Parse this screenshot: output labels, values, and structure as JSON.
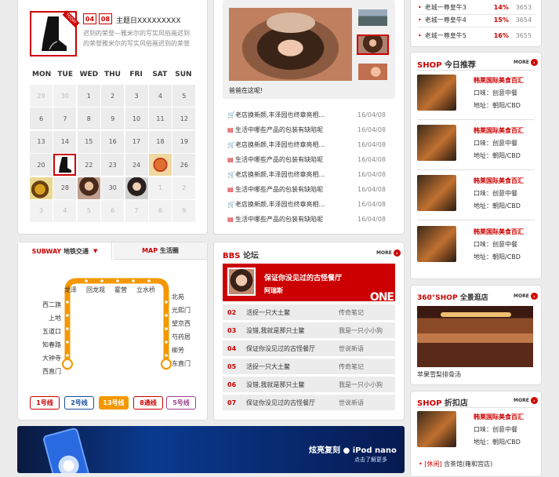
{
  "calendar": {
    "badge_month": "04",
    "badge_day": "08",
    "theme_title": "主题日XXXXXXXXX",
    "desc": "迟到的荣誉—雅米尔的写实风俗画迟到的荣誉雅米尔的写实风俗画迟到的荣誉",
    "weekdays": [
      "MON",
      "TUE",
      "WED",
      "THU",
      "FRI",
      "SAT",
      "SUN"
    ],
    "rows": [
      [
        "29",
        "30",
        "1",
        "2",
        "3",
        "4",
        "5"
      ],
      [
        "6",
        "7",
        "8",
        "9",
        "10",
        "11",
        "12"
      ],
      [
        "13",
        "14",
        "15",
        "16",
        "17",
        "18",
        "19"
      ],
      [
        "20",
        "",
        "22",
        "23",
        "24",
        "",
        "26"
      ],
      [
        "",
        "28",
        "",
        "30",
        "",
        "1",
        "2"
      ],
      [
        "3",
        "4",
        "5",
        "6",
        "7",
        "8",
        "9"
      ]
    ]
  },
  "top_right_list": [
    {
      "name": "老城一尊皇牛3",
      "pct": "14%",
      "num": "3653"
    },
    {
      "name": "老城一尊皇牛4",
      "pct": "15%",
      "num": "3654"
    },
    {
      "name": "老城一尊皇牛5",
      "pct": "16%",
      "num": "3655"
    }
  ],
  "feature": {
    "caption": "爸爸在这呢!"
  },
  "news": [
    {
      "title": "老店换新颜,丰泽园也终章亮相...",
      "date": "16/04/08",
      "icon": "cart-icon"
    },
    {
      "title": "生活中哪些产品的包装有缺陷呢",
      "date": "16/04/08",
      "icon": "doc-icon"
    },
    {
      "title": "老店换新颜,丰泽园也终章亮相...",
      "date": "16/04/08",
      "icon": "cart-icon"
    },
    {
      "title": "生活中哪些产品的包装有缺陷呢",
      "date": "16/04/08",
      "icon": "doc-icon"
    },
    {
      "title": "老店换新颜,丰泽园也终章亮相...",
      "date": "16/04/08",
      "icon": "cart-icon"
    },
    {
      "title": "生活中哪些产品的包装有缺陷呢",
      "date": "16/04/08",
      "icon": "doc-icon"
    },
    {
      "title": "老店换新颜,丰泽园也终章亮相...",
      "date": "16/04/08",
      "icon": "cart-icon"
    },
    {
      "title": "生活中哪些产品的包装有缺陷呢",
      "date": "16/04/08",
      "icon": "doc-icon"
    }
  ],
  "tabs": {
    "subway_en": "SUBWAY",
    "subway_cn": "地铁交通",
    "map_en": "MAP",
    "map_cn": "生活圈"
  },
  "subway": {
    "top_stations": [
      "龙泽",
      "回龙观",
      "霍营",
      "立水桥"
    ],
    "left_stations": [
      "西二旗",
      "上地",
      "五道口",
      "知春路",
      "大钟寺",
      "西直门"
    ],
    "right_stations": [
      "北苑",
      "光熙门",
      "望京西",
      "芍药居",
      "柳芳",
      "东直门"
    ],
    "lines": [
      "1号线",
      "2号线",
      "13号线",
      "8通线",
      "5号线"
    ],
    "line_colors": [
      "#cc0000",
      "#1a4fa0",
      "#f39800",
      "#cc0000",
      "#a04090"
    ]
  },
  "bbs": {
    "title_en": "BBS",
    "title_cn": "论坛",
    "more": "MORE",
    "top_title": "保证你没见过的古怪餐厅",
    "top_user": "阿瑞斯",
    "top_tag": "ONE",
    "rows": [
      {
        "n": "02",
        "t": "活捉一只大土鳖",
        "a": "传奇笔记"
      },
      {
        "n": "03",
        "t": "没错,我就是那只土鳖",
        "a": "我是一只小小狗"
      },
      {
        "n": "04",
        "t": "保证你没见过的古怪餐厅",
        "a": "世说新语"
      },
      {
        "n": "05",
        "t": "活捉一只大土鳖",
        "a": "传奇笔记"
      },
      {
        "n": "06",
        "t": "没错,我就是那只土鳖",
        "a": "我是一只小小狗"
      },
      {
        "n": "07",
        "t": "保证你没见过的古怪餐厅",
        "a": "世说新语"
      }
    ]
  },
  "shop": {
    "title_en": "SHOP",
    "title_cn": "今日推荐",
    "more": "MORE",
    "items": [
      {
        "name": "韩莱国际美食百汇",
        "l1": "口味：创意中餐",
        "l2": "地址：朝阳/CBD"
      },
      {
        "name": "韩莱国际美食百汇",
        "l1": "口味：创意中餐",
        "l2": "地址：朝阳/CBD"
      },
      {
        "name": "韩莱国际美食百汇",
        "l1": "口味：创意中餐",
        "l2": "地址：朝阳/CBD"
      },
      {
        "name": "韩莱国际美食百汇",
        "l1": "口味：创意中餐",
        "l2": "地址：朝阳/CBD"
      }
    ]
  },
  "shop360": {
    "title_en": "360°SHOP",
    "title_cn": "全景逛店",
    "more": "MORE",
    "caption": "苹果雪梨排骨汤"
  },
  "discount": {
    "title_en": "SHOP",
    "title_cn": "折扣店",
    "more": "MORE",
    "item": {
      "name": "韩莱国际美食百汇",
      "l1": "口味：创意中餐",
      "l2": "地址：朝阳/CBD"
    },
    "list_tag": "[休闲]",
    "list_text": "含茶馆(雍和宫店)"
  },
  "banner": {
    "text1": "炫亮复刻",
    "brand": "iPod nano",
    "text2": "点击了解更多"
  }
}
